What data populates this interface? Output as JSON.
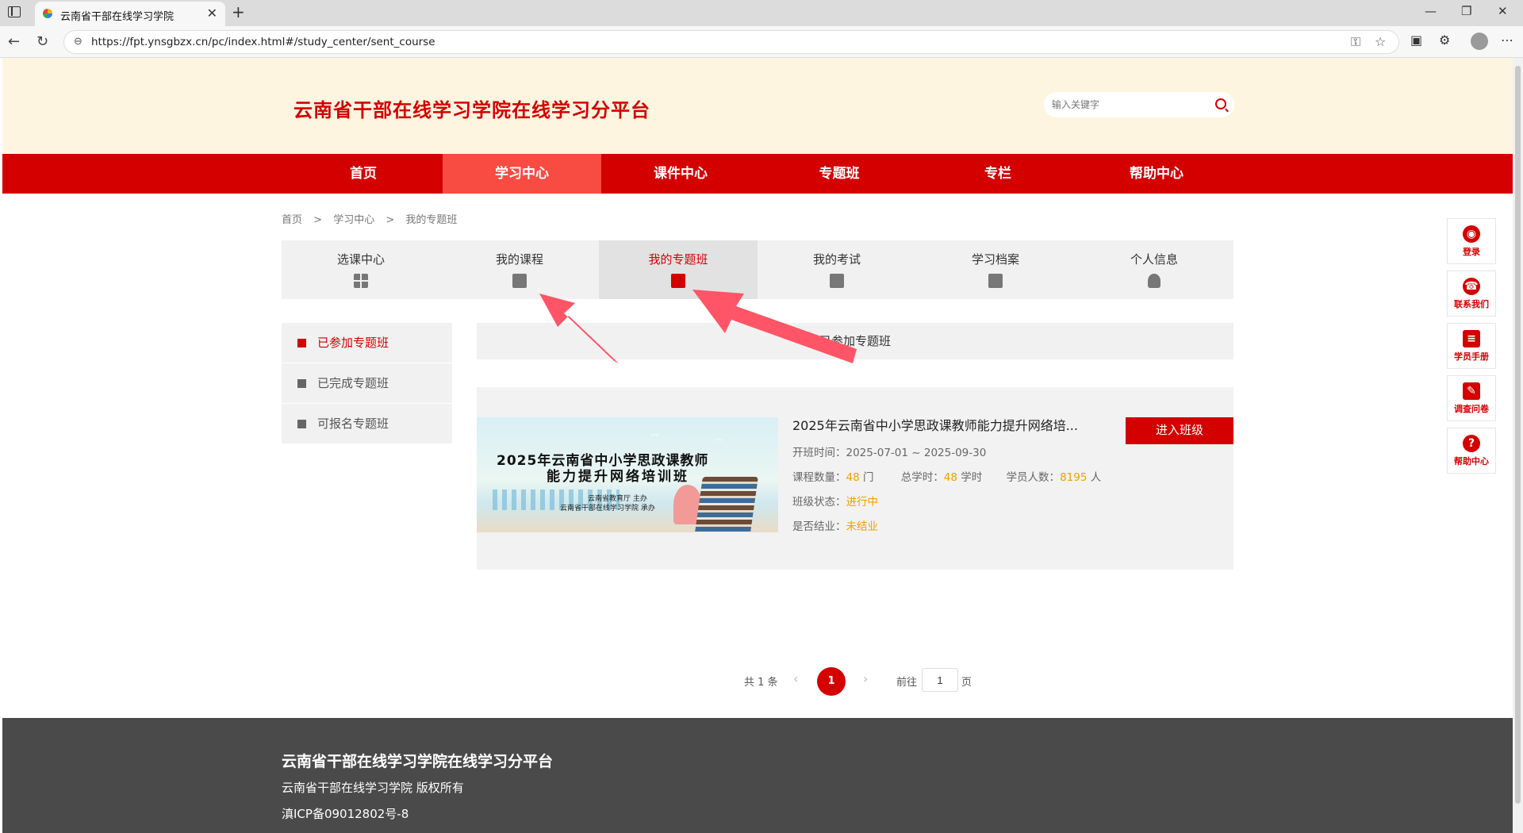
{
  "browser": {
    "tab_title": "云南省干部在线学习学院",
    "url": "https://fpt.ynsgbzx.cn/pc/index.html#/study_center/sent_course"
  },
  "header": {
    "site_title": "云南省干部在线学习学院在线学习分平台",
    "search_placeholder": "输入关键字"
  },
  "main_nav": [
    {
      "label": "首页",
      "active": false
    },
    {
      "label": "学习中心",
      "active": true
    },
    {
      "label": "课件中心",
      "active": false
    },
    {
      "label": "专题班",
      "active": false
    },
    {
      "label": "专栏",
      "active": false
    },
    {
      "label": "帮助中心",
      "active": false
    }
  ],
  "breadcrumb": [
    "首页",
    ">",
    "学习中心",
    ">",
    "我的专题班"
  ],
  "sub_nav": [
    {
      "label": "选课中心",
      "icon": "grid-icon",
      "active": false
    },
    {
      "label": "我的课程",
      "icon": "video-icon",
      "active": false
    },
    {
      "label": "我的专题班",
      "icon": "calendar-star-icon",
      "active": true
    },
    {
      "label": "我的考试",
      "icon": "edit-icon",
      "active": false
    },
    {
      "label": "学习档案",
      "icon": "document-icon",
      "active": false
    },
    {
      "label": "个人信息",
      "icon": "person-icon",
      "active": false
    }
  ],
  "side_menu": [
    {
      "label": "已参加专题班",
      "active": true
    },
    {
      "label": "已完成专题班",
      "active": false
    },
    {
      "label": "可报名专题班",
      "active": false
    }
  ],
  "content_heading": "已参加专题班",
  "course": {
    "thumb_line1": "2025年云南省中小学思政课教师",
    "thumb_line2": "能力提升网络培训班",
    "thumb_org1": "云南省教育厅  主办",
    "thumb_org2": "云南省干部在线学习学院  承办",
    "title": "2025年云南省中小学思政课教师能力提升网络培...",
    "period_label": "开班时间：",
    "period": "2025-07-01 ~ 2025-09-30",
    "count_label": "课程数量：",
    "count": "48",
    "count_unit": "门",
    "hours_label": "总学时：",
    "hours": "48",
    "hours_unit": "学时",
    "students_label": "学员人数：",
    "students": "8195",
    "students_unit": "人",
    "status_label": "班级状态：",
    "status": "进行中",
    "graduated_label": "是否结业：",
    "graduated": "未结业",
    "enter_label": "进入班级"
  },
  "pager": {
    "total": "共 1 条",
    "current": "1",
    "goto_label": "前往",
    "goto_value": "1",
    "page_unit": "页"
  },
  "footer": {
    "title": "云南省干部在线学习学院在线学习分平台",
    "copyright": "云南省干部在线学习学院    版权所有",
    "icp": "滇ICP备09012802号-8"
  },
  "float_bar": [
    {
      "label": "登录",
      "icon": "user-icon"
    },
    {
      "label": "联系我们",
      "icon": "phone-icon"
    },
    {
      "label": "学员手册",
      "icon": "books-icon"
    },
    {
      "label": "调查问卷",
      "icon": "survey-icon"
    },
    {
      "label": "帮助中心",
      "icon": "help-icon"
    }
  ],
  "colors": {
    "brand_red": "#d40000",
    "nav_active": "#f84b41",
    "header_bg": "#fdf5df",
    "accent_orange": "#f0a000",
    "annotation_arrow": "#ff5566"
  }
}
